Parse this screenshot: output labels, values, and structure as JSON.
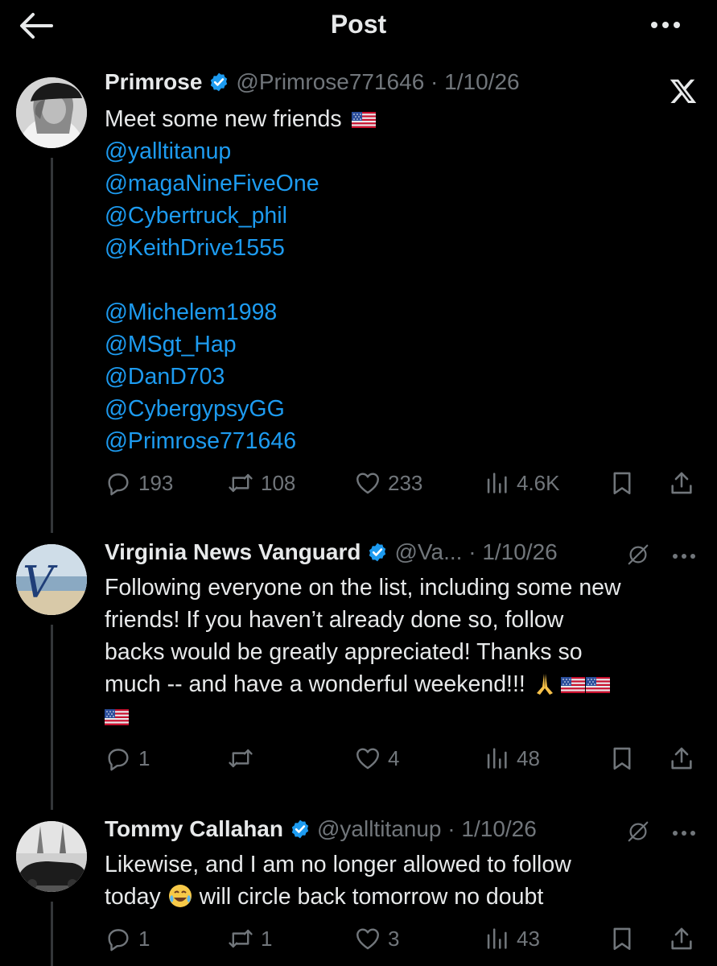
{
  "header": {
    "title": "Post"
  },
  "posts": [
    {
      "name": "Primrose",
      "handle": "@Primrose771646",
      "date": "1/10/26",
      "text": "Meet some new friends",
      "mentions_a": [
        "@yalltitanup",
        "@magaNineFiveOne",
        "@Cybertruck_phil",
        "@KeithDrive1555"
      ],
      "mentions_b": [
        "@Michelem1998",
        "@MSgt_Hap",
        "@DanD703",
        "@CybergypsyGG",
        "@Primrose771646"
      ],
      "replies": "193",
      "reposts": "108",
      "likes": "233",
      "views": "4.6K"
    },
    {
      "name": "Virginia News Vanguard",
      "handle": "@Va...",
      "date": "1/10/26",
      "lines": [
        "Following everyone on the list, including some new",
        "friends! If you haven’t already done so, follow",
        "backs would be greatly appreciated! Thanks so",
        "much -- and have a wonderful weekend!!!"
      ],
      "replies": "1",
      "reposts": "",
      "likes": "4",
      "views": "48"
    },
    {
      "name": "Tommy Callahan",
      "handle": "@yalltitanup",
      "date": "1/10/26",
      "line1": "Likewise, and I am no longer allowed to follow",
      "line2_a": "today",
      "line2_b": "will circle back tomorrow no doubt",
      "replies": "1",
      "reposts": "1",
      "likes": "3",
      "views": "43"
    }
  ],
  "colors": {
    "link": "#1d9bf0",
    "muted": "#71767b",
    "verified": "#1d9bf0",
    "background": "#000000"
  },
  "icons": [
    "back-arrow-icon",
    "more-icon",
    "x-logo-icon",
    "verified-icon",
    "grok-icon",
    "reply-icon",
    "repost-icon",
    "like-icon",
    "views-icon",
    "bookmark-icon",
    "share-icon"
  ]
}
